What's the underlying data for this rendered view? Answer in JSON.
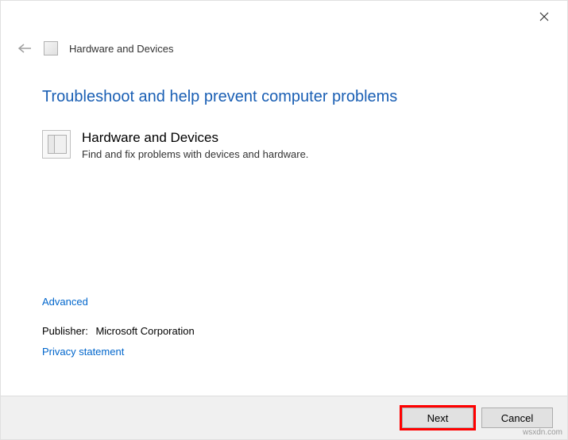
{
  "window": {
    "title": "Hardware and Devices"
  },
  "main": {
    "heading": "Troubleshoot and help prevent computer problems",
    "device_title": "Hardware and Devices",
    "device_desc": "Find and fix problems with devices and hardware."
  },
  "links": {
    "advanced": "Advanced",
    "privacy": "Privacy statement"
  },
  "publisher": {
    "label": "Publisher:",
    "value": "Microsoft Corporation"
  },
  "buttons": {
    "next": "Next",
    "cancel": "Cancel"
  },
  "watermark": "wsxdn.com"
}
